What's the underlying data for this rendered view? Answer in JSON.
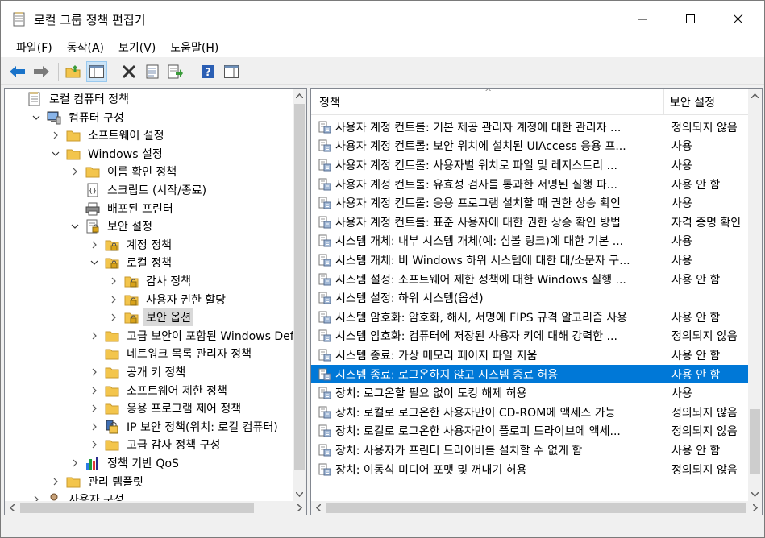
{
  "window": {
    "title": "로컬 그룹 정책 편집기"
  },
  "menu": [
    {
      "label": "파일(F)"
    },
    {
      "label": "동작(A)"
    },
    {
      "label": "보기(V)"
    },
    {
      "label": "도움말(H)"
    }
  ],
  "tree": [
    {
      "label": "로컬 컴퓨터 정책",
      "level": 0,
      "arrow": "none",
      "icon": "policy-doc-icon"
    },
    {
      "label": "컴퓨터 구성",
      "level": 1,
      "arrow": "down",
      "icon": "computer-icon"
    },
    {
      "label": "소프트웨어 설정",
      "level": 2,
      "arrow": "right",
      "icon": "folder-icon"
    },
    {
      "label": "Windows 설정",
      "level": 2,
      "arrow": "down",
      "icon": "folder-icon"
    },
    {
      "label": "이름 확인 정책",
      "level": 3,
      "arrow": "right",
      "icon": "folder-icon"
    },
    {
      "label": "스크립트 (시작/종료)",
      "level": 3,
      "arrow": "none",
      "icon": "script-icon"
    },
    {
      "label": "배포된 프린터",
      "level": 3,
      "arrow": "none",
      "icon": "printer-icon"
    },
    {
      "label": "보안 설정",
      "level": 3,
      "arrow": "down",
      "icon": "security-doc-icon"
    },
    {
      "label": "계정 정책",
      "level": 4,
      "arrow": "right",
      "icon": "secure-folder-icon"
    },
    {
      "label": "로컬 정책",
      "level": 4,
      "arrow": "down",
      "icon": "secure-folder-icon"
    },
    {
      "label": "감사 정책",
      "level": 5,
      "arrow": "right",
      "icon": "secure-folder-icon"
    },
    {
      "label": "사용자 권한 할당",
      "level": 5,
      "arrow": "right",
      "icon": "secure-folder-icon"
    },
    {
      "label": "보안 옵션",
      "level": 5,
      "arrow": "right",
      "icon": "secure-folder-icon",
      "selected": true
    },
    {
      "label": "고급 보안이 포함된 Windows Def",
      "level": 4,
      "arrow": "right",
      "icon": "folder-icon"
    },
    {
      "label": "네트워크 목록 관리자 정책",
      "level": 4,
      "arrow": "none",
      "icon": "folder-icon"
    },
    {
      "label": "공개 키 정책",
      "level": 4,
      "arrow": "right",
      "icon": "folder-icon"
    },
    {
      "label": "소프트웨어 제한 정책",
      "level": 4,
      "arrow": "right",
      "icon": "folder-icon"
    },
    {
      "label": "응용 프로그램 제어 정책",
      "level": 4,
      "arrow": "right",
      "icon": "folder-icon"
    },
    {
      "label": "IP 보안 정책(위치: 로컬 컴퓨터)",
      "level": 4,
      "arrow": "right",
      "icon": "ip-security-icon"
    },
    {
      "label": "고급 감사 정책 구성",
      "level": 4,
      "arrow": "right",
      "icon": "folder-icon"
    },
    {
      "label": "정책 기반 QoS",
      "level": 3,
      "arrow": "right",
      "icon": "chart-icon"
    },
    {
      "label": "관리 템플릿",
      "level": 2,
      "arrow": "right",
      "icon": "folder-icon"
    },
    {
      "label": "사용자 구성",
      "level": 1,
      "arrow": "right",
      "icon": "user-icon"
    }
  ],
  "list": {
    "headers": {
      "policy": "정책",
      "setting": "보안 설정"
    },
    "rows": [
      {
        "policy": "사용자 계정 컨트롤: 기본 제공 관리자 계정에 대한 관리자 ...",
        "setting": "정의되지 않음"
      },
      {
        "policy": "사용자 계정 컨트롤: 보안 위치에 설치된 UIAccess 응용 프...",
        "setting": "사용"
      },
      {
        "policy": "사용자 계정 컨트롤: 사용자별 위치로 파일 및 레지스트리 ...",
        "setting": "사용"
      },
      {
        "policy": "사용자 계정 컨트롤: 유효성 검사를 통과한 서명된 실행 파...",
        "setting": "사용 안 함"
      },
      {
        "policy": "사용자 계정 컨트롤: 응용 프로그램 설치할 때 권한 상승 확인",
        "setting": "사용"
      },
      {
        "policy": "사용자 계정 컨트롤: 표준 사용자에 대한 권한 상승 확인 방법",
        "setting": "자격 증명 확인"
      },
      {
        "policy": "시스템 개체: 내부 시스템 개체(예: 심볼 링크)에 대한 기본 ...",
        "setting": "사용"
      },
      {
        "policy": "시스템 개체: 비 Windows 하위 시스템에 대한 대/소문자 구...",
        "setting": "사용"
      },
      {
        "policy": "시스템 설정: 소프트웨어 제한 정책에 대한 Windows 실행 ...",
        "setting": "사용 안 함"
      },
      {
        "policy": "시스템 설정: 하위 시스템(옵션)",
        "setting": ""
      },
      {
        "policy": "시스템 암호화: 암호화, 해시, 서명에 FIPS 규격 알고리즘 사용",
        "setting": "사용 안 함"
      },
      {
        "policy": "시스템 암호화: 컴퓨터에 저장된 사용자 키에 대해 강력한 ...",
        "setting": "정의되지 않음"
      },
      {
        "policy": "시스템 종료: 가상 메모리 페이지 파일 지움",
        "setting": "사용 안 함"
      },
      {
        "policy": "시스템 종료: 로그온하지 않고 시스템 종료 허용",
        "setting": "사용 안 함",
        "selected": true
      },
      {
        "policy": "장치: 로그온할 필요 없이 도킹 해제 허용",
        "setting": "사용"
      },
      {
        "policy": "장치: 로컬로 로그온한 사용자만이 CD-ROM에 액세스 가능",
        "setting": "정의되지 않음"
      },
      {
        "policy": "장치: 로컬로 로그온한 사용자만이 플로피 드라이브에 액세...",
        "setting": "정의되지 않음"
      },
      {
        "policy": "장치: 사용자가 프린터 드라이버를 설치할 수 없게 함",
        "setting": "사용 안 함"
      },
      {
        "policy": "장치: 이동식 미디어 포맷 및 꺼내기 허용",
        "setting": "정의되지 않음"
      }
    ]
  },
  "toolbar": [
    {
      "icon": "back-arrow-icon"
    },
    {
      "icon": "forward-arrow-icon"
    },
    {
      "icon": "up-folder-icon"
    },
    {
      "icon": "show-hide-tree-icon",
      "pressed": true
    },
    {
      "icon": "delete-icon"
    },
    {
      "icon": "properties-icon"
    },
    {
      "icon": "export-list-icon"
    },
    {
      "icon": "help-icon"
    },
    {
      "icon": "show-hide-action-pane-icon"
    }
  ],
  "colors": {
    "selection": "#0078d7",
    "tree_selection": "#d9d9d9",
    "folder": "#f3c54c",
    "link_blue": "#1a73c9"
  }
}
